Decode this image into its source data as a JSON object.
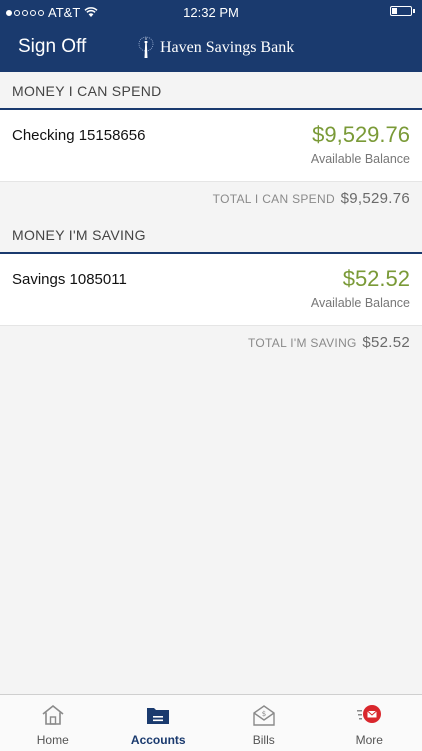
{
  "status_bar": {
    "carrier": "AT&T",
    "time": "12:32 PM",
    "battery_level": 0.3
  },
  "nav": {
    "sign_off_label": "Sign Off",
    "brand_name": "Haven Savings Bank"
  },
  "spend_section": {
    "title": "MONEY I CAN SPEND",
    "account": {
      "name": "Checking 15158656",
      "balance": "$9,529.76",
      "balance_label": "Available Balance"
    },
    "total_label": "TOTAL I CAN SPEND",
    "total_amount": "$9,529.76"
  },
  "saving_section": {
    "title": "MONEY I'M SAVING",
    "account": {
      "name": "Savings 1085011",
      "balance": "$52.52",
      "balance_label": "Available Balance"
    },
    "total_label": "TOTAL I'M SAVING",
    "total_amount": "$52.52"
  },
  "tabs": [
    {
      "label": "Home",
      "icon": "home-icon",
      "active": false
    },
    {
      "label": "Accounts",
      "icon": "accounts-folder-icon",
      "active": true
    },
    {
      "label": "Bills",
      "icon": "bills-envelope-icon",
      "active": false
    },
    {
      "label": "More",
      "icon": "more-mail-icon",
      "active": false
    }
  ],
  "colors": {
    "brand": "#1a3a6e",
    "balance": "#7a9a37",
    "notification": "#d9262c"
  }
}
